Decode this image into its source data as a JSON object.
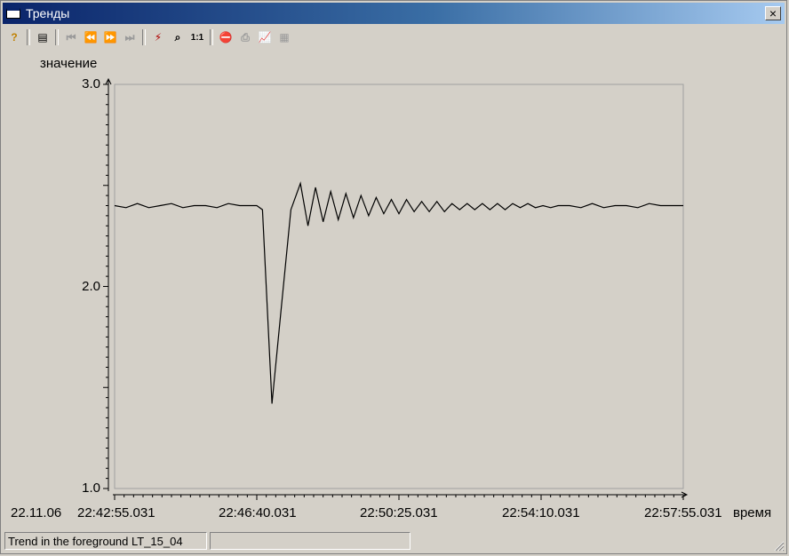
{
  "window": {
    "title": "Тренды",
    "close_label": "×"
  },
  "toolbar": {
    "buttons": [
      {
        "icon": "help-icon",
        "glyph": "?",
        "enabled": true
      },
      {
        "icon": "table-view-icon",
        "glyph": "▤",
        "enabled": true
      },
      {
        "icon": "first-icon",
        "glyph": "⏮",
        "enabled": false
      },
      {
        "icon": "back-icon",
        "glyph": "⏪",
        "enabled": false
      },
      {
        "icon": "forward-icon",
        "glyph": "⏩",
        "enabled": false
      },
      {
        "icon": "last-icon",
        "glyph": "⏭",
        "enabled": false
      },
      {
        "icon": "select-trend-icon",
        "glyph": "⚡",
        "enabled": true
      },
      {
        "icon": "zoom-icon",
        "glyph": "⌕",
        "enabled": true
      },
      {
        "icon": "original-size-icon",
        "glyph": "1:1",
        "enabled": true
      },
      {
        "icon": "stop-icon",
        "glyph": "⛔",
        "enabled": true
      },
      {
        "icon": "print-icon",
        "glyph": "⎙",
        "enabled": false
      },
      {
        "icon": "statistics-icon",
        "glyph": "📈",
        "enabled": true
      },
      {
        "icon": "export-icon",
        "glyph": "▦",
        "enabled": false
      }
    ]
  },
  "chart_data": {
    "type": "line",
    "ylabel": "значение",
    "xlabel": "время",
    "ylim": [
      1.0,
      3.0
    ],
    "yticks": [
      "3.0",
      "2.0",
      "1.0"
    ],
    "date_label": "22.11.06",
    "xticks": [
      "22:42:55.031",
      "22:46:40.031",
      "22:50:25.031",
      "22:54:10.031",
      "22:57:55.031"
    ],
    "x_range_minutes": [
      0,
      15
    ],
    "grid": false,
    "series": [
      {
        "color": "#000000",
        "x": [
          0,
          0.3,
          0.6,
          0.9,
          1.2,
          1.5,
          1.8,
          2.1,
          2.4,
          2.7,
          3.0,
          3.3,
          3.6,
          3.75,
          3.9,
          4.15,
          4.4,
          4.65,
          4.9,
          5.1,
          5.3,
          5.5,
          5.7,
          5.9,
          6.1,
          6.3,
          6.5,
          6.7,
          6.9,
          7.1,
          7.3,
          7.5,
          7.7,
          7.9,
          8.1,
          8.3,
          8.5,
          8.7,
          8.9,
          9.1,
          9.3,
          9.5,
          9.7,
          9.9,
          10.1,
          10.3,
          10.5,
          10.7,
          10.9,
          11.1,
          11.3,
          11.5,
          11.7,
          12.0,
          12.3,
          12.6,
          12.9,
          13.2,
          13.5,
          13.8,
          14.1,
          14.4,
          14.7,
          15.0
        ],
        "values": [
          2.4,
          2.39,
          2.41,
          2.39,
          2.4,
          2.41,
          2.39,
          2.4,
          2.4,
          2.39,
          2.41,
          2.4,
          2.4,
          2.4,
          2.38,
          1.42,
          1.9,
          2.38,
          2.51,
          2.3,
          2.49,
          2.32,
          2.47,
          2.33,
          2.46,
          2.34,
          2.45,
          2.35,
          2.44,
          2.36,
          2.43,
          2.36,
          2.43,
          2.37,
          2.42,
          2.37,
          2.42,
          2.37,
          2.41,
          2.38,
          2.41,
          2.38,
          2.41,
          2.38,
          2.41,
          2.38,
          2.41,
          2.39,
          2.41,
          2.39,
          2.4,
          2.39,
          2.4,
          2.4,
          2.39,
          2.41,
          2.39,
          2.4,
          2.4,
          2.39,
          2.41,
          2.4,
          2.4,
          2.4
        ]
      }
    ]
  },
  "status": {
    "left": "Trend in the foreground LT_15_04",
    "right": ""
  }
}
